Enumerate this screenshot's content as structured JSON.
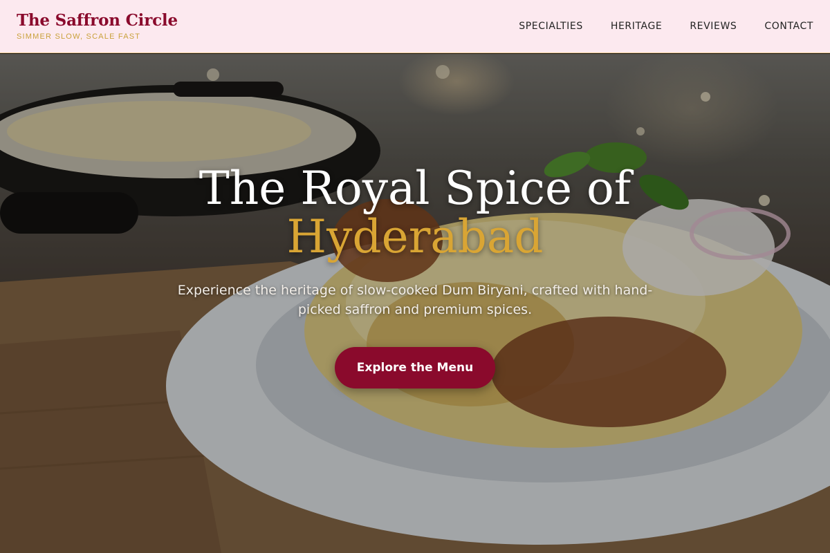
{
  "brand": {
    "name": "The Saffron Circle",
    "tagline": "SIMMER SLOW, SCALE FAST"
  },
  "nav": {
    "items": [
      {
        "label": "SPECIALTIES"
      },
      {
        "label": "HERITAGE"
      },
      {
        "label": "REVIEWS"
      },
      {
        "label": "CONTACT"
      }
    ]
  },
  "hero": {
    "title_line1": "The Royal Spice of",
    "title_line2": "Hyderabad",
    "subtitle": "Experience the heritage of slow-cooked Dum Biryani, crafted with hand-picked saffron and premium spices.",
    "cta_label": "Explore the Menu",
    "image_subject": "biryani-plate-photo"
  },
  "colors": {
    "brand": "#8a0a2c",
    "accent": "#d9a534",
    "nav_bg": "#fce9ef"
  }
}
